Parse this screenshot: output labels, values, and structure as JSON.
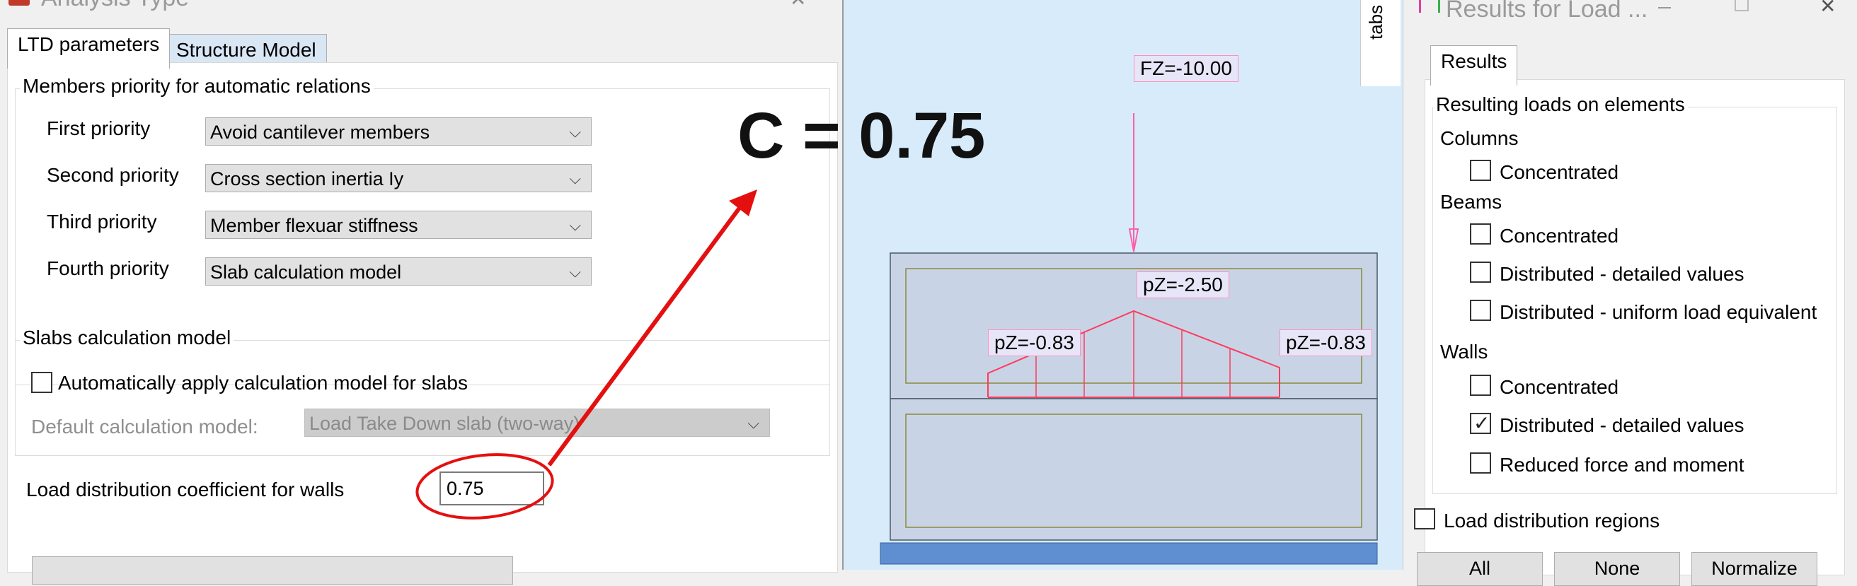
{
  "left_dialog": {
    "title": "Analysis Type",
    "tabs": [
      "LTD parameters",
      "Structure Model"
    ],
    "members_priority": {
      "title": "Members priority for automatic relations",
      "rows": [
        {
          "label": "First priority",
          "value": "Avoid cantilever members"
        },
        {
          "label": "Second priority",
          "value": "Cross section inertia Iy"
        },
        {
          "label": "Third priority",
          "value": "Member flexuar stiffness"
        },
        {
          "label": "Fourth priority",
          "value": "Slab calculation model"
        }
      ]
    },
    "slabs": {
      "title": "Slabs calculation model",
      "auto_apply_label": "Automatically apply calculation model for slabs",
      "default_model_label": "Default calculation model:",
      "default_model_value": "Load Take Down slab (two-way)"
    },
    "load_dist": {
      "label": "Load distribution coefficient for walls",
      "value": "0.75"
    }
  },
  "annotation": {
    "big_text": "C = 0.75",
    "color": "#e41010"
  },
  "viewport": {
    "side_tab": "tabs",
    "load_labels": {
      "fz": "FZ=-10.00",
      "pz_center": "pZ=-2.50",
      "pz_left": "pZ=-0.83",
      "pz_right": "pZ=-0.83"
    }
  },
  "right_window": {
    "title": "Results for Load ...",
    "tab": "Results",
    "section_title": "Resulting loads on elements",
    "columns": {
      "label": "Columns",
      "items": [
        {
          "label": "Concentrated",
          "checked": false
        }
      ]
    },
    "beams": {
      "label": "Beams",
      "items": [
        {
          "label": "Concentrated",
          "checked": false
        },
        {
          "label": "Distributed - detailed values",
          "checked": false
        },
        {
          "label": "Distributed - uniform load equivalent",
          "checked": false
        }
      ]
    },
    "walls": {
      "label": "Walls",
      "items": [
        {
          "label": "Concentrated",
          "checked": false
        },
        {
          "label": "Distributed - detailed values",
          "checked": true
        },
        {
          "label": "Reduced force and moment",
          "checked": false
        }
      ]
    },
    "regions_label": "Load distribution regions",
    "buttons": [
      "All",
      "None",
      "Normalize"
    ]
  }
}
